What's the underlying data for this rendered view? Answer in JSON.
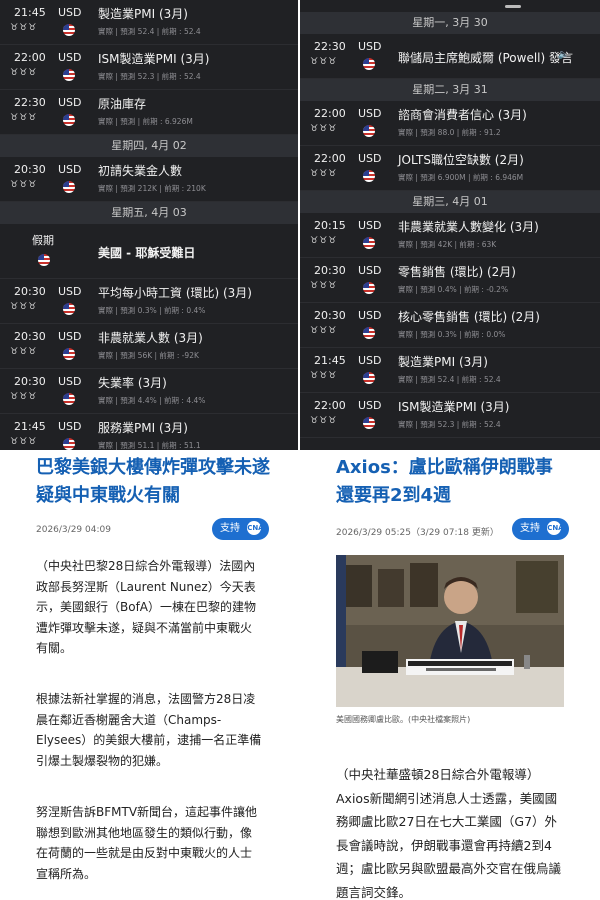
{
  "left_calendar": {
    "top_events": [
      {
        "time": "21:45",
        "cur": "USD",
        "title": "製造業PMI (3月)",
        "meta": "實際 | 預測 52.4 | 前期 :  52.4"
      },
      {
        "time": "22:00",
        "cur": "USD",
        "title": "ISM製造業PMI (3月)",
        "meta": "實際 | 預測 52.3 | 前期 :  52.4"
      },
      {
        "time": "22:30",
        "cur": "USD",
        "title": "原油庫存",
        "meta": "實際 | 預測 | 前期 :  6.926M"
      }
    ],
    "thursday": {
      "date": "星期四, 4月 02",
      "events": [
        {
          "time": "20:30",
          "cur": "USD",
          "title": "初請失業金人數",
          "meta": "實際 | 預測 212K | 前期 :  210K"
        }
      ]
    },
    "friday": {
      "date": "星期五, 4月 03",
      "holiday": {
        "label": "假期",
        "title": "美國 - 耶穌受難日"
      },
      "events": [
        {
          "time": "20:30",
          "cur": "USD",
          "title": "平均每小時工資 (環比) (3月)",
          "meta": "實際 | 預測 0.3% | 前期 :  0.4%"
        },
        {
          "time": "20:30",
          "cur": "USD",
          "title": "非農就業人數 (3月)",
          "meta": "實際 | 預測 56K | 前期 :  -92K"
        },
        {
          "time": "20:30",
          "cur": "USD",
          "title": "失業率 (3月)",
          "meta": "實際 | 預測 4.4% | 前期 :  4.4%"
        },
        {
          "time": "21:45",
          "cur": "USD",
          "title": "服務業PMI (3月)",
          "meta": "實際 | 預測 51.1 | 前期 :  51.1"
        }
      ]
    }
  },
  "right_calendar": {
    "monday": {
      "date": "星期一, 3月 30",
      "events": [
        {
          "time": "22:30",
          "cur": "USD",
          "title": "聯儲局主席鮑威爾 (Powell) 發言",
          "meta": ""
        }
      ]
    },
    "tuesday": {
      "date": "星期二, 3月 31",
      "events": [
        {
          "time": "22:00",
          "cur": "USD",
          "title": "諮商會消費者信心 (3月)",
          "meta": "實際 | 預測 88.0 | 前期 :  91.2"
        },
        {
          "time": "22:00",
          "cur": "USD",
          "title": "JOLTS職位空缺數 (2月)",
          "meta": "實際 | 預測 6.900M | 前期 :  6.946M"
        }
      ]
    },
    "wednesday": {
      "date": "星期三, 4月 01",
      "events": [
        {
          "time": "20:15",
          "cur": "USD",
          "title": "非農業就業人數變化 (3月)",
          "meta": "實際 | 預測 42K | 前期 :  63K"
        },
        {
          "time": "20:30",
          "cur": "USD",
          "title": "零售銷售 (環比) (2月)",
          "meta": "實際 | 預測 0.4% | 前期 :  -0.2%"
        },
        {
          "time": "20:30",
          "cur": "USD",
          "title": "核心零售銷售 (環比) (2月)",
          "meta": "實際 | 預測 0.3% | 前期 :  0.0%"
        },
        {
          "time": "21:45",
          "cur": "USD",
          "title": "製造業PMI (3月)",
          "meta": "實際 | 預測 52.4 | 前期 :  52.4"
        },
        {
          "time": "22:00",
          "cur": "USD",
          "title": "ISM製造業PMI (3月)",
          "meta": "實際 | 預測 52.3 | 前期 :  52.4"
        }
      ]
    }
  },
  "importance_stars": "♉♉♉",
  "speaker_icon": "🔈",
  "left_article": {
    "headline": "巴黎美銀大樓傳炸彈攻擊未遂　疑與中東戰火有關",
    "date": "2026/3/29 04:09",
    "support_label": "支持",
    "support_logo": "CNA",
    "paragraphs": [
      "（中央社巴黎28日綜合外電報導）法國內政部長努涅斯（Laurent Nunez）今天表示，美國銀行（BofA）一棟在巴黎的建物遭炸彈攻擊未遂，疑與不滿當前中東戰火有關。",
      "根據法新社掌握的消息，法國警方28日凌晨在鄰近香榭麗舍大道（Champs-Elysees）的美銀大樓前，逮捕一名正準備引爆土製爆裂物的犯嫌。",
      "努涅斯告訴BFMTV新聞台，這起事件讓他聯想到歐洲其他地區發生的類似行動，像在荷蘭的一些就是由反對中東戰火的人士宣稱所為。"
    ]
  },
  "right_article": {
    "headline": "Axios：盧比歐稱伊朗戰事還要再2到4週",
    "date": "2026/3/29 05:25（3/29 07:18 更新）",
    "support_label": "支持",
    "support_logo": "CNA",
    "photo_caption": "美國國務卿盧比歐。(中央社檔案照片)",
    "paragraph": "（中央社華盛頓28日綜合外電報導）Axios新聞網引述消息人士透露，美國國務卿盧比歐27日在七大工業國（G7）外長會議時說，伊朗戰事還會再持續2到4週；盧比歐另與歐盟最高外交官在俄烏議題言詞交鋒。"
  },
  "colors": {
    "dark_bg": "#202124",
    "date_bar": "#2e3035",
    "headline_blue": "#1560b3",
    "support_blue": "#1e6fd0"
  }
}
